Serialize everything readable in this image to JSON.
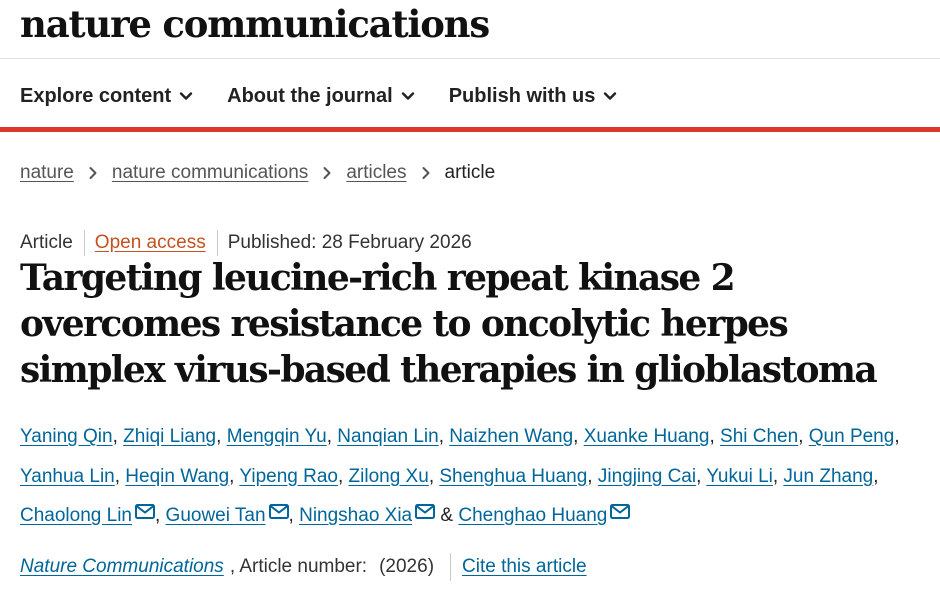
{
  "site": {
    "logo": "nature communications"
  },
  "nav": {
    "items": [
      {
        "label": "Explore content",
        "icon": "chevron-down-icon"
      },
      {
        "label": "About the journal",
        "icon": "chevron-down-icon"
      },
      {
        "label": "Publish with us",
        "icon": "chevron-down-icon"
      }
    ]
  },
  "colors": {
    "accent_rule": "#e03629",
    "link": "#006699",
    "open_access": "#c4511f"
  },
  "breadcrumb": {
    "items": [
      "nature",
      "nature communications",
      "articles"
    ],
    "current": "article",
    "separator_icon": "chevron-right-icon"
  },
  "article": {
    "type": "Article",
    "open_access": "Open access",
    "published": "Published: 28 February 2026",
    "title": "Targeting leucine-rich repeat kinase 2 overcomes resistance to oncolytic herpes simplex virus-based therapies in glioblastoma",
    "authors": [
      {
        "name": "Yaning Qin"
      },
      {
        "name": "Zhiqi Liang"
      },
      {
        "name": "Mengqin Yu"
      },
      {
        "name": "Nanqian Lin"
      },
      {
        "name": "Naizhen Wang"
      },
      {
        "name": "Xuanke Huang"
      },
      {
        "name": "Shi Chen"
      },
      {
        "name": "Qun Peng"
      },
      {
        "name": "Yanhua Lin"
      },
      {
        "name": "Heqin Wang"
      },
      {
        "name": "Yipeng Rao"
      },
      {
        "name": "Zilong Xu"
      },
      {
        "name": "Shenghua Huang"
      },
      {
        "name": "Jingjing Cai"
      },
      {
        "name": "Yukui Li"
      },
      {
        "name": "Jun Zhang"
      },
      {
        "name": "Chaolong Lin",
        "corresponding": true
      },
      {
        "name": "Guowei Tan",
        "corresponding": true
      },
      {
        "name": "Ningshao Xia",
        "corresponding": true
      },
      {
        "name": "Chenghao Huang",
        "corresponding": true
      }
    ],
    "author_separator": ",",
    "author_conjunction": "&",
    "corresponding_icon": "mail-icon"
  },
  "citation": {
    "journal": "Nature Communications",
    "article_number_label": ", Article number:",
    "year": "(2026)",
    "cite_link": "Cite this article"
  }
}
